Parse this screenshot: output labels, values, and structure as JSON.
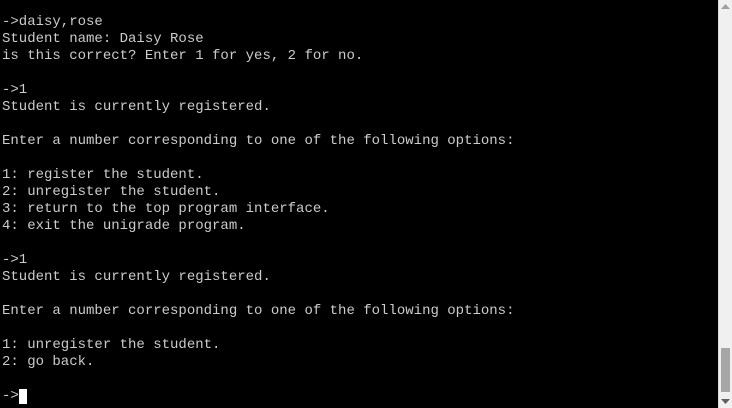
{
  "terminal": {
    "lines": [
      "->daisy,rose",
      "Student name: Daisy Rose",
      "is this correct? Enter 1 for yes, 2 for no.",
      "",
      "->1",
      "Student is currently registered.",
      "",
      "Enter a number corresponding to one of the following options:",
      "",
      "1: register the student.",
      "2: unregister the student.",
      "3: return to the top program interface.",
      "4: exit the unigrade program.",
      "",
      "->1",
      "Student is currently registered.",
      "",
      "Enter a number corresponding to one of the following options:",
      "",
      "1: unregister the student.",
      "2: go back.",
      ""
    ],
    "prompt": "->",
    "text_color": "#cccccc",
    "background_color": "#000000"
  },
  "scrollbar": {
    "up_icon": "triangle-up-icon",
    "down_icon": "triangle-down-icon",
    "position_fraction": 0.93
  }
}
